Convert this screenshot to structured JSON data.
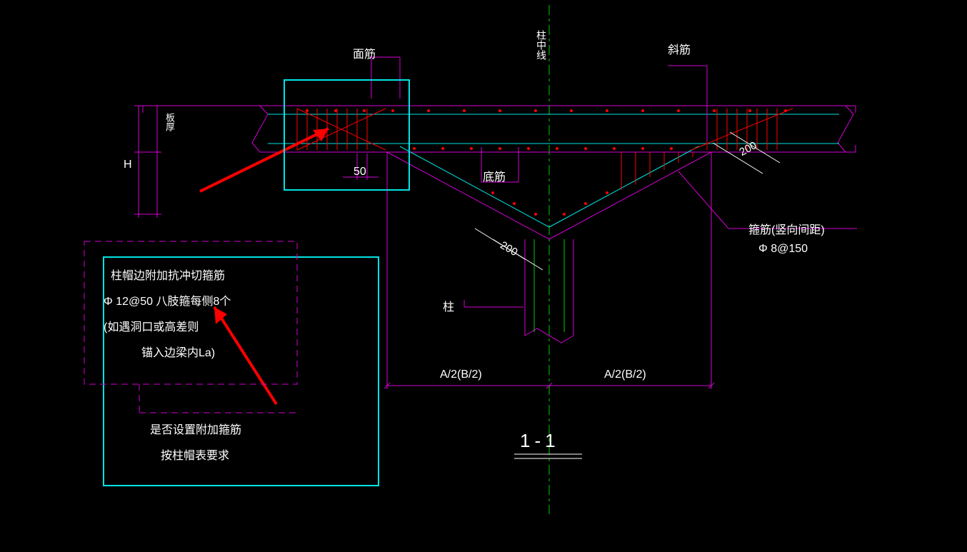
{
  "labels": {
    "top_rebar": "面筋",
    "diagonal_rebar": "斜筋",
    "column_centerline": "柱中线",
    "bottom_rebar": "底筋",
    "column": "柱",
    "slab_thickness": "板厚",
    "height_H": "H",
    "dim_50": "50",
    "dim_200_left": "200",
    "dim_200_right": "200",
    "half_span_left": "A/2(B/2)",
    "half_span_right": "A/2(B/2)",
    "stirrup_title": "箍筋(竖向间距)",
    "stirrup_spec": "Φ 8@150",
    "section_title": "1-1"
  },
  "note_box": {
    "line1": "柱帽边附加抗冲切箍筋",
    "line2": "Φ 12@50 八肢箍每侧8个",
    "line3": "(如遇洞口或高差则",
    "line4": "锚入边梁内La)",
    "line5": "是否设置附加箍筋",
    "line6": "按柱帽表要求"
  }
}
